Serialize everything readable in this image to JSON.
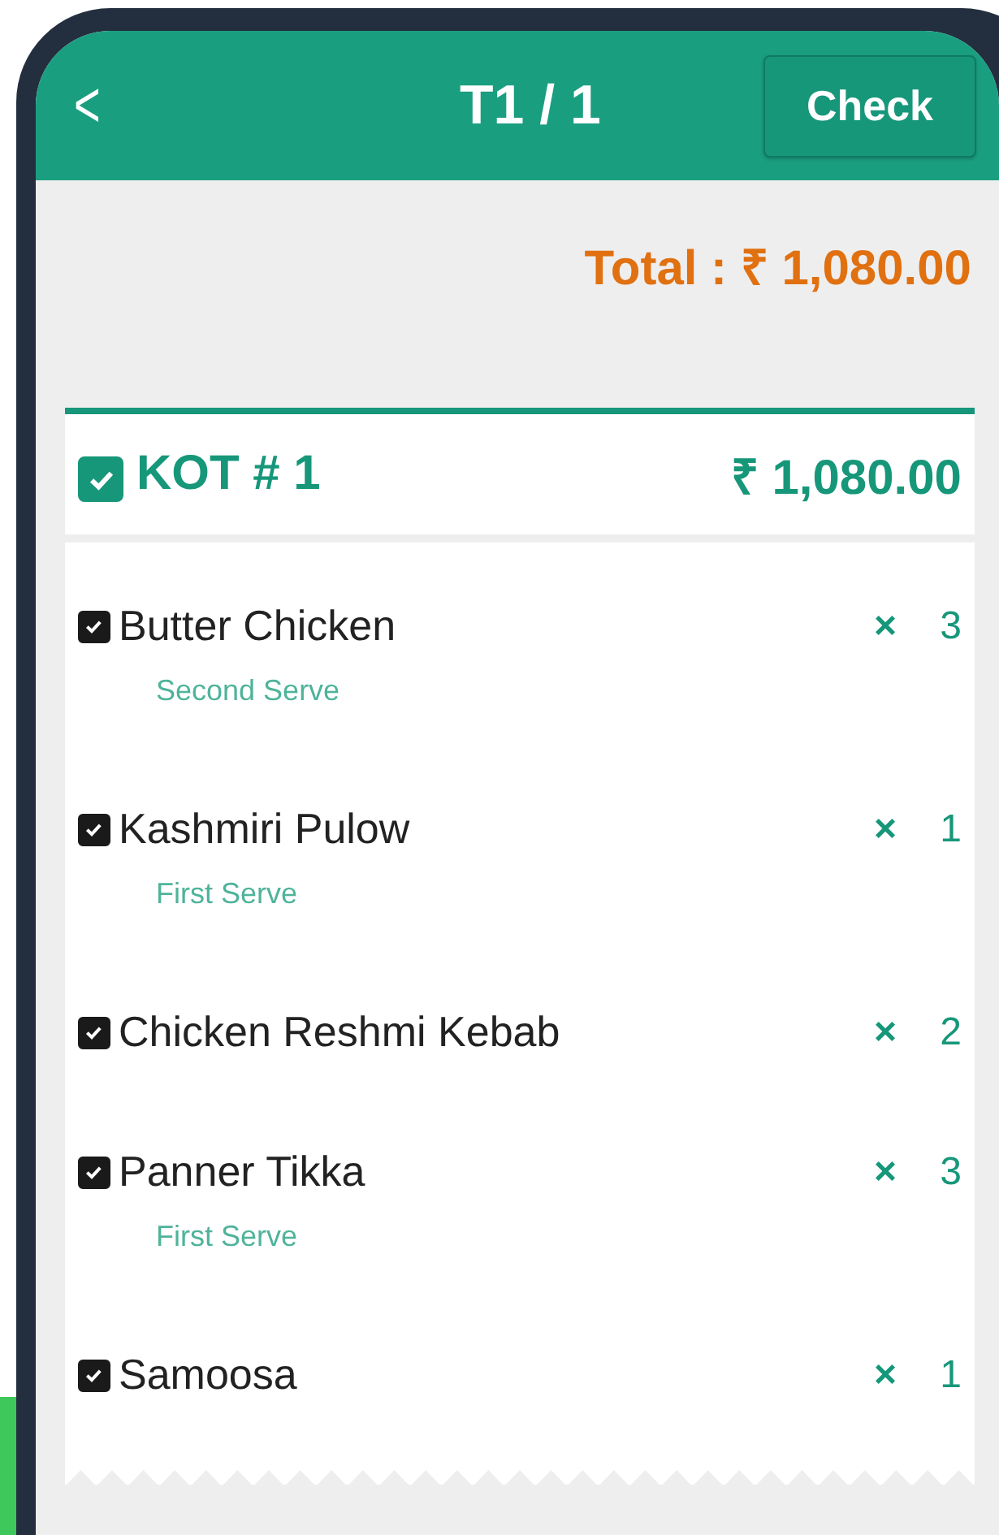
{
  "header": {
    "back_glyph": "<",
    "title": "T1 / 1",
    "action": "Check"
  },
  "total": "Total : ₹ 1,080.00",
  "kot": {
    "label": "KOT # 1",
    "amount": "₹ 1,080.00",
    "checked": true
  },
  "items": [
    {
      "name": "Butter Chicken",
      "serve": "Second Serve",
      "times": "×",
      "qty": "3",
      "checked": true
    },
    {
      "name": "Kashmiri Pulow",
      "serve": "First Serve",
      "times": "×",
      "qty": "1",
      "checked": true
    },
    {
      "name": "Chicken Reshmi Kebab",
      "times": "×",
      "qty": "2",
      "checked": true
    },
    {
      "name": "Panner Tikka",
      "serve": "First Serve",
      "times": "×",
      "qty": "3",
      "checked": true
    },
    {
      "name": "Samoosa",
      "times": "×",
      "qty": "1",
      "checked": true
    }
  ]
}
